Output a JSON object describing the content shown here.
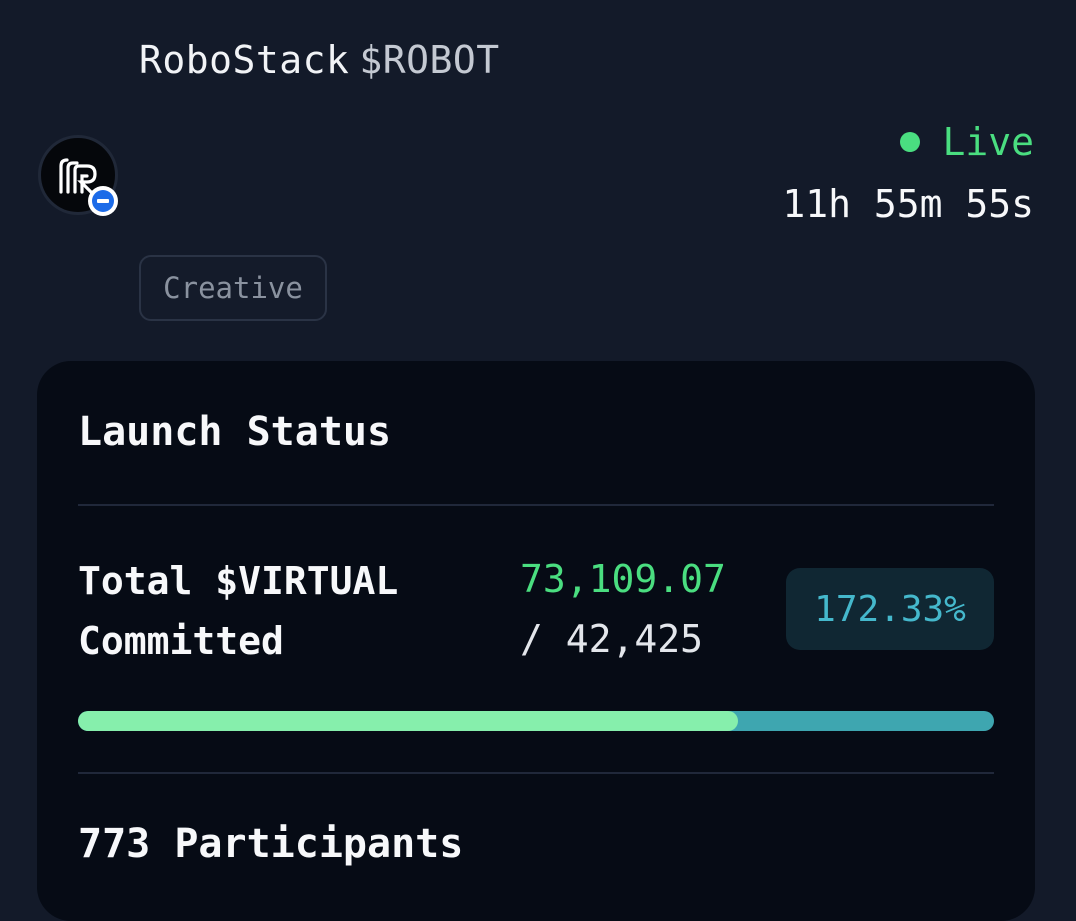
{
  "token": {
    "name": "RoboStack",
    "ticker": "$ROBOT",
    "avatar_icon": "robostack-logo-icon",
    "verified_icon": "verified-badge-icon"
  },
  "status": {
    "live_label": "Live",
    "countdown": "11h 55m 55s"
  },
  "tag": {
    "label": "Creative"
  },
  "launch_status": {
    "title": "Launch Status",
    "commit_label_line1": "Total $VIRTUAL",
    "commit_label_line2": "Committed",
    "committed_value": "73,109.07",
    "target_value": "/ 42,425",
    "percent_label": "172.33%",
    "progress_fill_fraction": 0.72,
    "participants": "773 Participants"
  },
  "colors": {
    "background": "#131a29",
    "card": "#060b15",
    "live_green": "#4ade80",
    "progress_fill": "#86efac",
    "progress_track": "#3ea6b0",
    "badge_text": "#45b8cc"
  }
}
